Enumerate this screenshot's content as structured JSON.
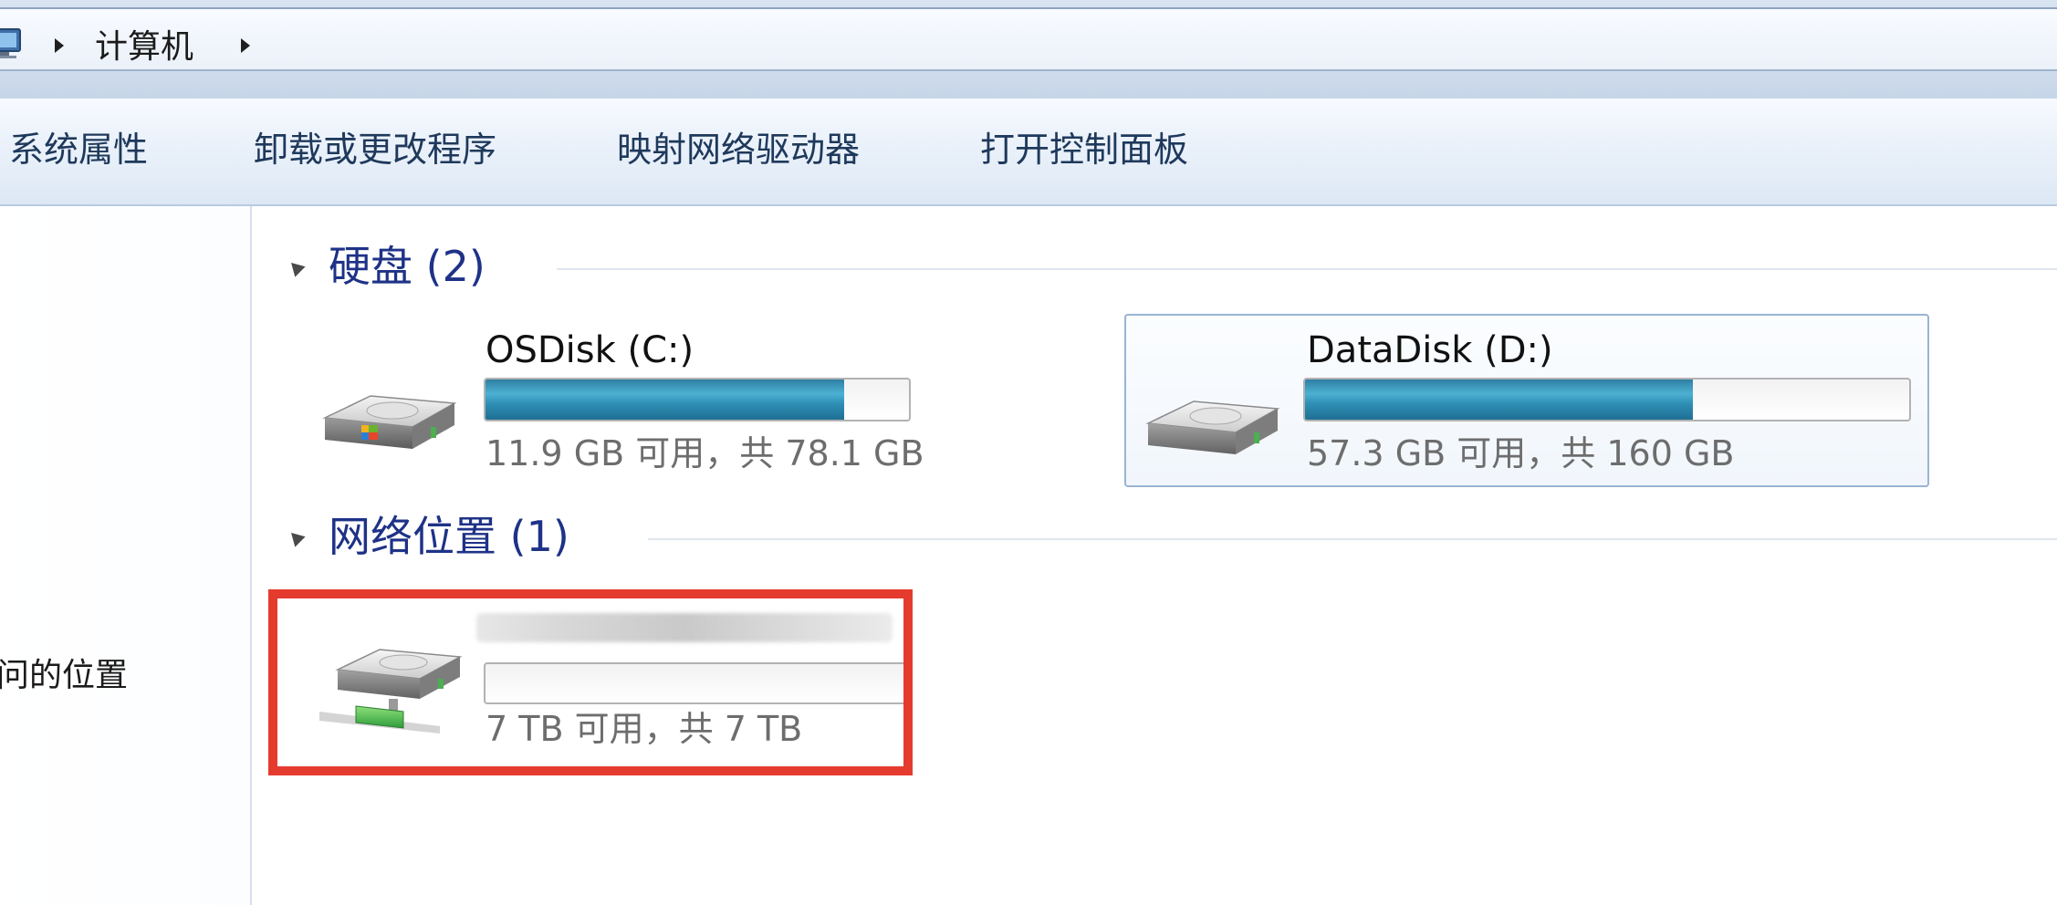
{
  "address": {
    "icon": "computer-icon",
    "crumbs": [
      "计算机"
    ]
  },
  "toolbar": {
    "buttons": [
      "系统属性",
      "卸载或更改程序",
      "映射网络驱动器",
      "打开控制面板"
    ]
  },
  "nav": {
    "items": [
      {
        "label": "访问的位置"
      }
    ]
  },
  "groups": {
    "hard_disks": {
      "title": "硬盘 (2)",
      "drives": [
        {
          "name": "OSDisk (C:)",
          "used_fraction": 0.848,
          "size_text": "11.9 GB 可用，共 78.1 GB",
          "icon": "windows-system-drive-icon"
        },
        {
          "name": "DataDisk (D:)",
          "used_fraction": 0.642,
          "size_text": "57.3 GB 可用，共 160 GB",
          "icon": "hard-drive-icon",
          "selected": true
        }
      ]
    },
    "network": {
      "title": "网络位置 (1)",
      "drives": [
        {
          "name": "",
          "used_fraction": 0.0,
          "size_text": "7 TB 可用，共 7 TB",
          "icon": "network-drive-icon"
        }
      ]
    }
  },
  "colors": {
    "group_title": "#1e3287",
    "bar_fill": "#2f8fb5",
    "highlight": "#e53b2f"
  }
}
